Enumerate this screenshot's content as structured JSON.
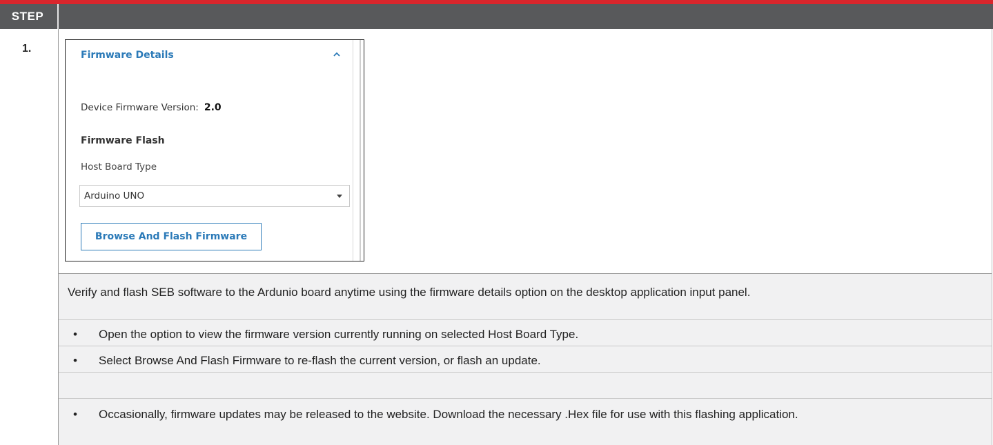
{
  "header": {
    "step_label": "STEP"
  },
  "row": {
    "step_number": "1."
  },
  "panel": {
    "title": "Firmware Details",
    "fw_version_label": "Device Firmware Version:",
    "fw_version_value": "2.0",
    "flash_title": "Firmware Flash",
    "host_board_label": "Host Board Type",
    "host_board_value": "Arduino UNO",
    "flash_button": "Browse And Flash Firmware",
    "colors": {
      "accent": "#2b7ab8"
    }
  },
  "instructions": {
    "paragraph": "Verify and flash SEB software to the Ardunio board anytime using the firmware details option on the desktop application input panel.",
    "bullets": [
      "Open the option to view the firmware version currently running on selected Host Board Type.",
      "Select Browse And Flash Firmware to re-flash the current version, or flash an update.",
      "Occasionally, firmware updates may be released to the website. Download the necessary .Hex file for use with this flashing application."
    ]
  },
  "colors": {
    "brand_red": "#d9262c",
    "header_gray": "#58595b"
  }
}
